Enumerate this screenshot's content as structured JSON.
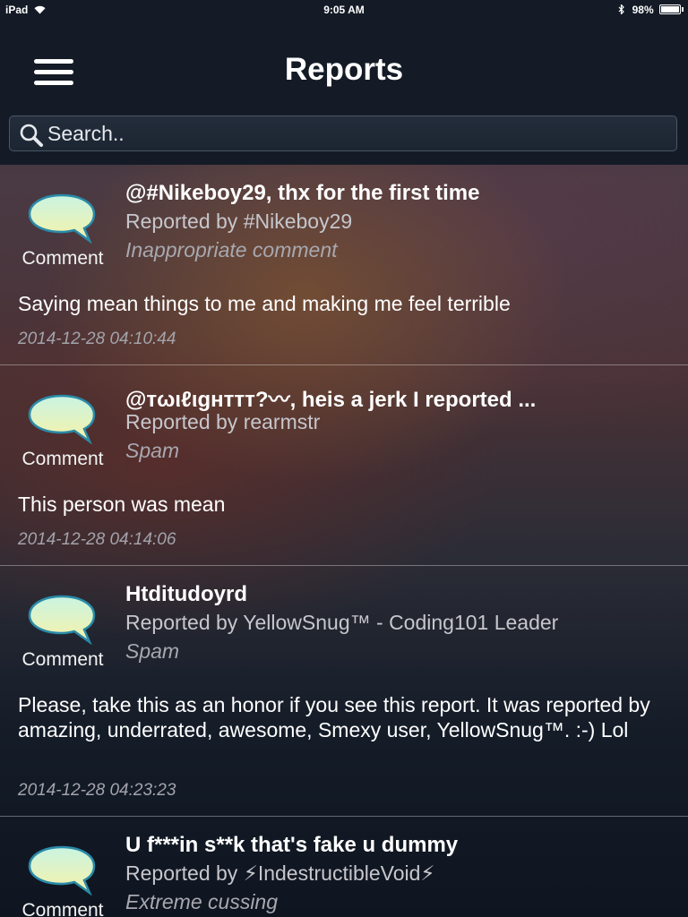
{
  "status_bar": {
    "device": "iPad",
    "time": "9:05 AM",
    "battery_text": "98%",
    "battery_level": 0.98
  },
  "header": {
    "title": "Reports"
  },
  "search": {
    "placeholder": "Search.."
  },
  "reports": [
    {
      "type": "Comment",
      "title": "@#Nikeboy29, thx for the first time",
      "reporter": "Reported by #Nikeboy29",
      "reason": "Inappropriate comment",
      "comment": "Saying mean things to me and making me feel terrible",
      "timestamp": "2014-12-28 04:10:44"
    },
    {
      "type": "Comment",
      "title": "@тωιℓιgнттт?〰, heis a jerk I reported ...",
      "reporter": "Reported by rearmstr",
      "reason": "Spam",
      "comment": "This person was mean",
      "timestamp": "2014-12-28 04:14:06"
    },
    {
      "type": "Comment",
      "title": "Htditudoyrd",
      "reporter": "Reported by YellowSnug™ - Coding101 Leader",
      "reason": "Spam",
      "comment": "Please, take this as an honor if you see this report. It was reported by amazing, underrated, awesome, Smexy user, YellowSnug™. :-) Lol",
      "timestamp": "2014-12-28 04:23:23"
    },
    {
      "type": "Comment",
      "title": "U f***in s**k that's fake u dummy",
      "reporter": "Reported by ⚡IndestructibleVoid⚡",
      "reason": "Extreme cussing",
      "comment": "",
      "timestamp": ""
    }
  ]
}
